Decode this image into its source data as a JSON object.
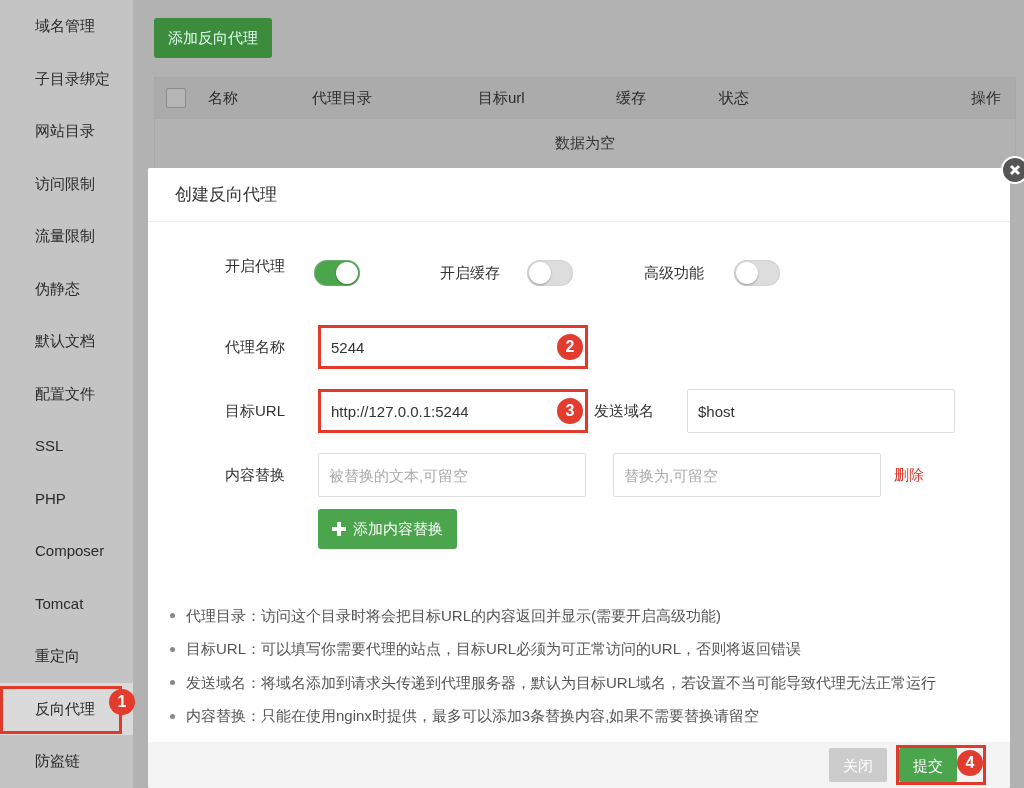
{
  "sidebar": {
    "items": [
      {
        "label": "域名管理",
        "selected": false
      },
      {
        "label": "子目录绑定",
        "selected": false
      },
      {
        "label": "网站目录",
        "selected": false
      },
      {
        "label": "访问限制",
        "selected": false
      },
      {
        "label": "流量限制",
        "selected": false
      },
      {
        "label": "伪静态",
        "selected": false
      },
      {
        "label": "默认文档",
        "selected": false
      },
      {
        "label": "配置文件",
        "selected": false
      },
      {
        "label": "SSL",
        "selected": false
      },
      {
        "label": "PHP",
        "selected": false
      },
      {
        "label": "Composer",
        "selected": false
      },
      {
        "label": "Tomcat",
        "selected": false
      },
      {
        "label": "重定向",
        "selected": false
      },
      {
        "label": "反向代理",
        "selected": true,
        "annotation": "1"
      },
      {
        "label": "防盗链",
        "selected": false
      }
    ]
  },
  "main": {
    "add_button": "添加反向代理",
    "table": {
      "select_all_checked": false,
      "columns": [
        "名称",
        "代理目录",
        "目标url",
        "缓存",
        "状态",
        "操作"
      ],
      "empty_text": "数据为空"
    }
  },
  "dialog": {
    "title": "创建反向代理",
    "toggles": [
      {
        "label": "开启代理",
        "on": true
      },
      {
        "label": "开启缓存",
        "on": false
      },
      {
        "label": "高级功能",
        "on": false
      }
    ],
    "rows": [
      {
        "label": "代理名称",
        "inputs": [
          {
            "value": "5244",
            "annotation": "2"
          }
        ]
      },
      {
        "label": "目标URL",
        "inputs": [
          {
            "value": "http://127.0.0.1:5244",
            "annotation": "3"
          },
          {
            "label": "发送域名",
            "value": "$host"
          }
        ]
      },
      {
        "label": "内容替换",
        "inputs": [
          {
            "placeholder": "被替换的文本,可留空"
          },
          {
            "placeholder": "替换为,可留空"
          }
        ],
        "action": "删除"
      }
    ],
    "add_replace_button": "添加内容替换",
    "notes": [
      "代理目录：访问这个目录时将会把目标URL的内容返回并显示(需要开启高级功能)",
      "目标URL：可以填写你需要代理的站点，目标URL必须为可正常访问的URL，否则将返回错误",
      "发送域名：将域名添加到请求头传递到代理服务器，默认为目标URL域名，若设置不当可能导致代理无法正常运行",
      "内容替换：只能在使用nginx时提供，最多可以添加3条替换内容,如果不需要替换请留空"
    ],
    "buttons": [
      {
        "label": "关闭",
        "kind": "secondary"
      },
      {
        "label": "提交",
        "kind": "primary",
        "annotation": "4"
      }
    ]
  }
}
